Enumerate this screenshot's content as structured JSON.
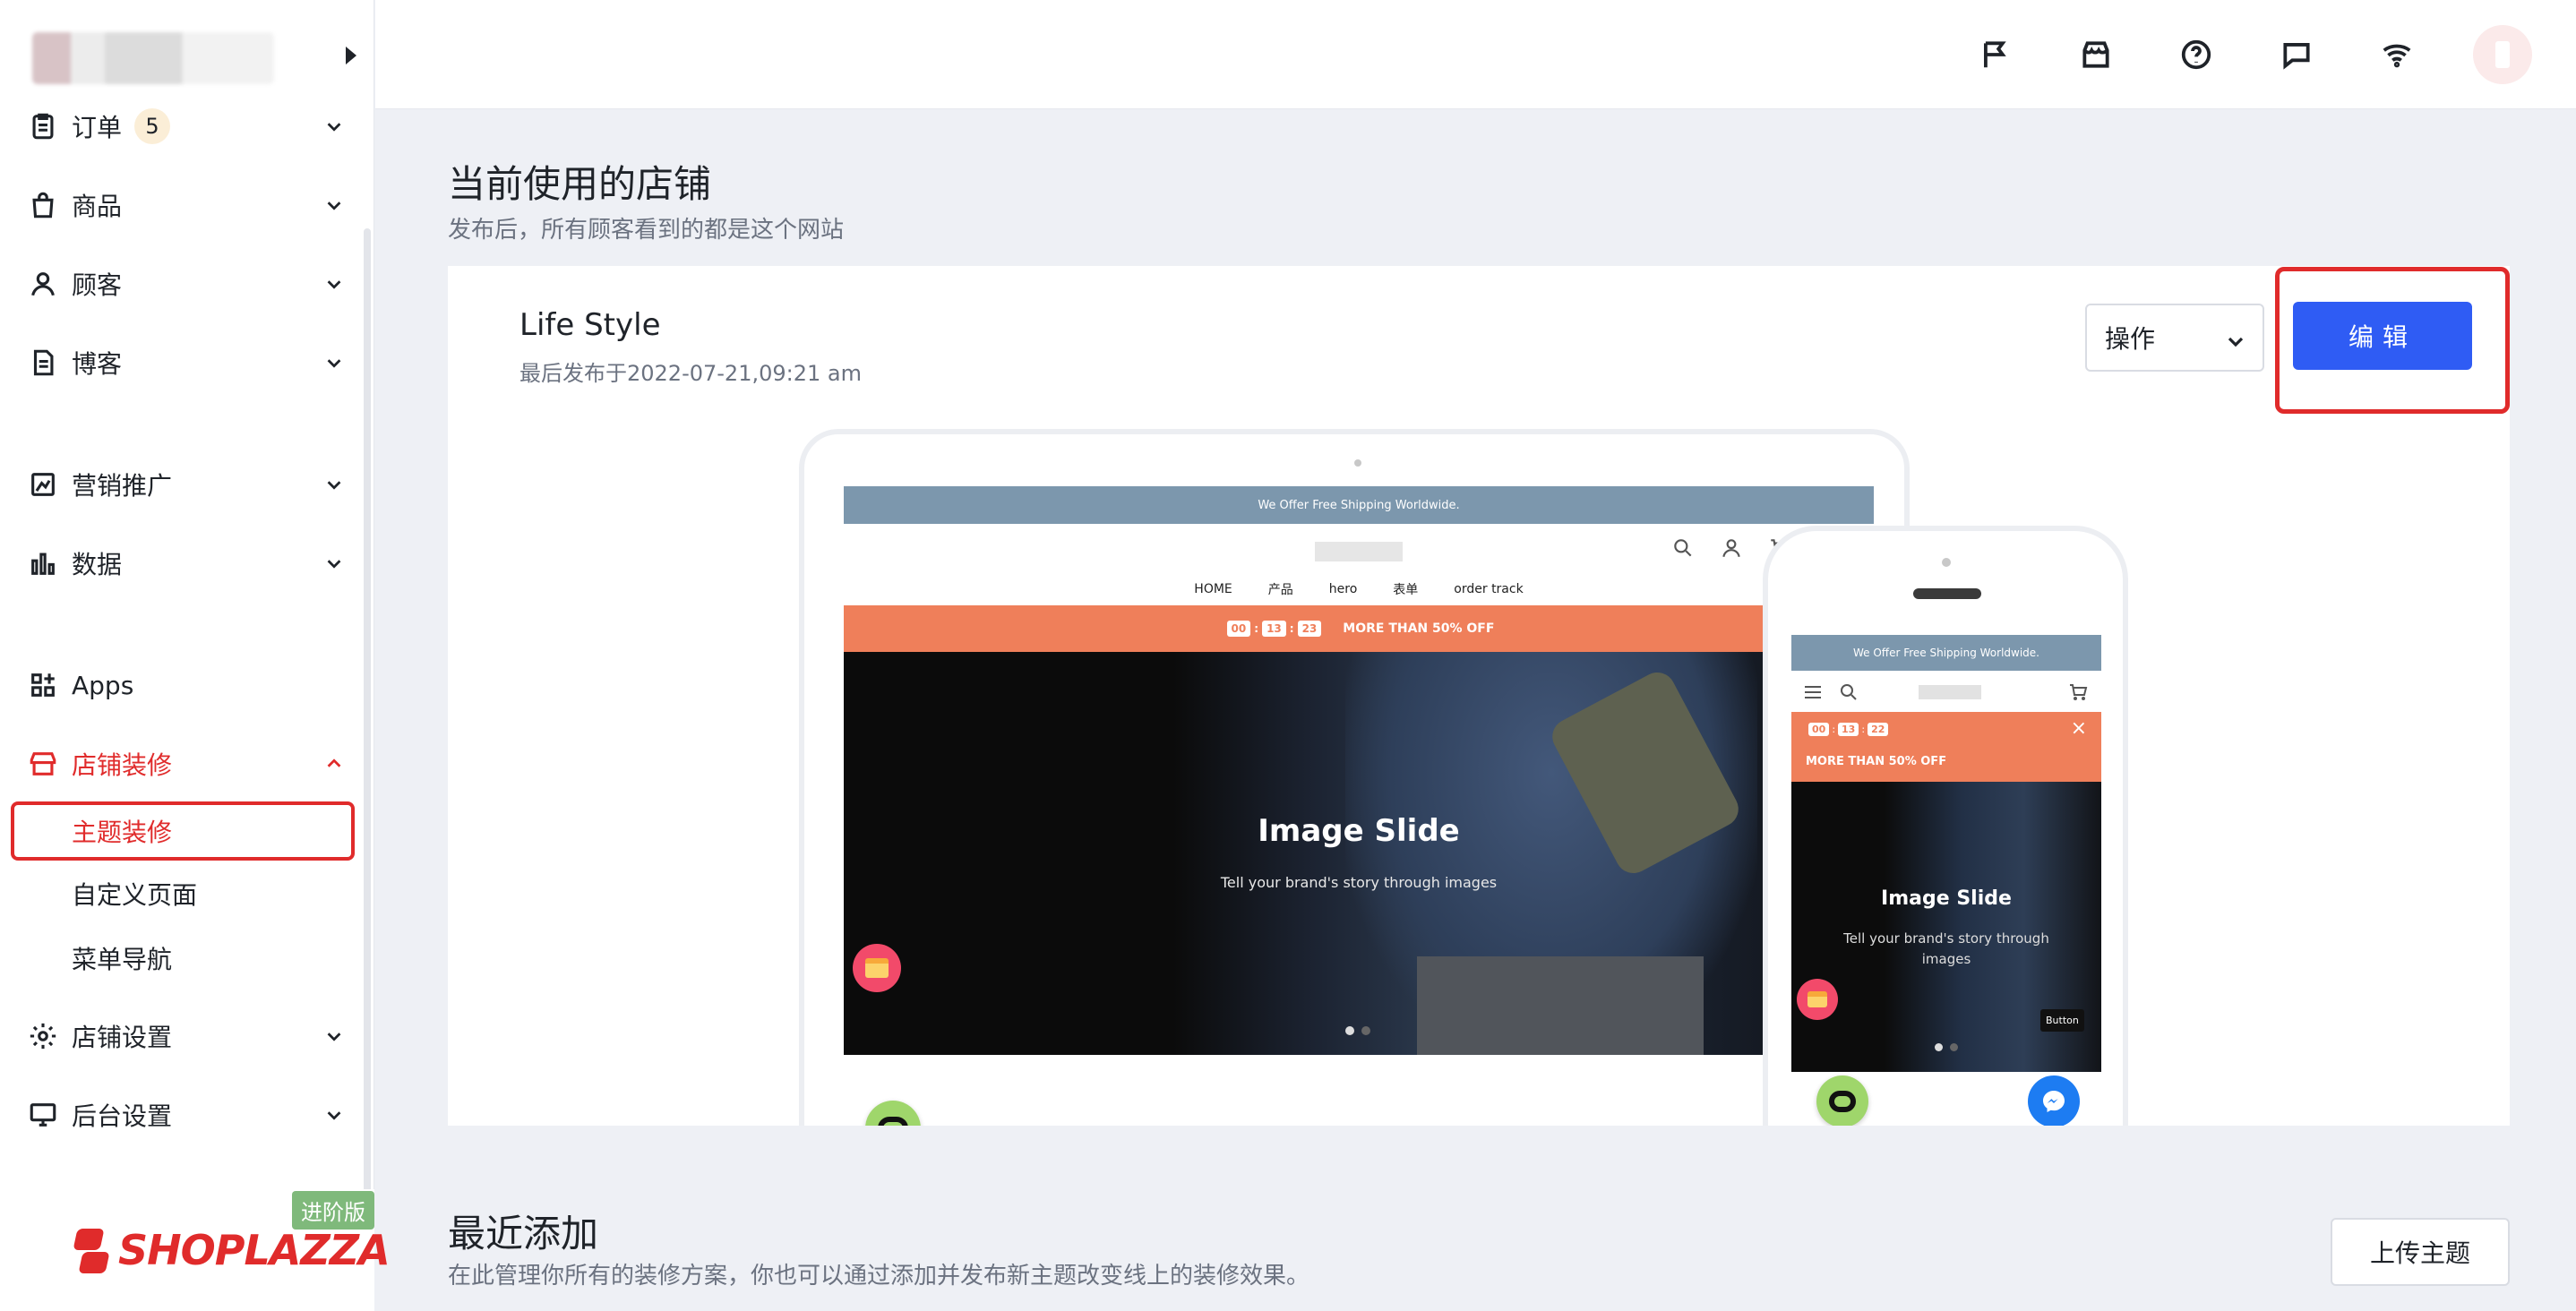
{
  "sidebar": {
    "nav": [
      {
        "label": "订单",
        "badge": "5"
      },
      {
        "label": "商品"
      },
      {
        "label": "顾客"
      },
      {
        "label": "博客"
      },
      {
        "label": "营销推广"
      },
      {
        "label": "数据"
      },
      {
        "label": "Apps"
      },
      {
        "label": "店铺装修"
      },
      {
        "label": "店铺设置"
      },
      {
        "label": "后台设置"
      }
    ],
    "sub_items": [
      "主题装修",
      "自定义页面",
      "菜单导航"
    ],
    "brand": {
      "text": "SHOPLAZZA",
      "plan_badge": "进阶版"
    }
  },
  "current": {
    "title": "当前使用的店铺",
    "subtitle": "发布后，所有顾客看到的都是这个网站",
    "theme_name": "Life Style",
    "published": "最后发布于2022-07-21,09:21 am",
    "ops_label": "操作",
    "edit_label": "编辑"
  },
  "preview": {
    "shipping": "We Offer Free Shipping Worldwide.",
    "nav": [
      "HOME",
      "产品",
      "hero",
      "表单",
      "order track"
    ],
    "countdown": [
      "00",
      "13",
      "23"
    ],
    "promo": "MORE THAN 50% OFF",
    "hero_title": "Image Slide",
    "hero_sub": "Tell your brand's story through images",
    "phone_countdown": [
      "00",
      "13",
      "22"
    ],
    "phone_button_tip": "Button"
  },
  "recent": {
    "title": "最近添加",
    "subtitle": "在此管理你所有的装修方案，你也可以通过添加并发布新主题改变线上的装修效果。",
    "upload_label": "上传主题"
  },
  "colors": {
    "accent_red": "#e02b2b",
    "primary_blue": "#2f5cf4",
    "promo_orange": "#ef7f5a",
    "banner_blue": "#7c97ad"
  }
}
